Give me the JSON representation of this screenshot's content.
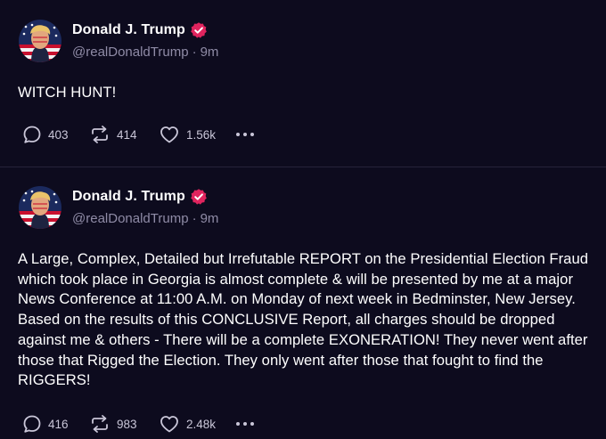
{
  "posts": [
    {
      "author": {
        "display_name": "Donald J. Trump",
        "handle": "@realDonaldTrump",
        "separator": "·",
        "time": "9m"
      },
      "text": "WITCH HUNT!",
      "stats": {
        "replies": "403",
        "reposts": "414",
        "likes": "1.56k"
      }
    },
    {
      "author": {
        "display_name": "Donald J. Trump",
        "handle": "@realDonaldTrump",
        "separator": "·",
        "time": "9m"
      },
      "text": "A Large, Complex, Detailed but Irrefutable REPORT on the Presidential Election Fraud which took place in Georgia is almost complete & will be presented by me at a major News Conference at 11:00 A.M. on Monday of next week in Bedminster, New Jersey. Based on the results of this CONCLUSIVE Report, all charges should be dropped against me & others - There will be a complete EXONERATION! They never went after those that Rigged the Election. They only went after those that fought to find the RIGGERS!",
      "stats": {
        "replies": "416",
        "reposts": "983",
        "likes": "2.48k"
      }
    }
  ],
  "icons": {
    "verified": "verified-badge-icon",
    "reply": "reply-bubble-icon",
    "repost": "repost-arrows-icon",
    "like": "heart-icon",
    "more": "more-dots-icon"
  },
  "colors": {
    "background": "#0d0b1e",
    "text": "#ffffff",
    "muted": "#8f8ba6",
    "verified_badge": "#e0245e"
  }
}
